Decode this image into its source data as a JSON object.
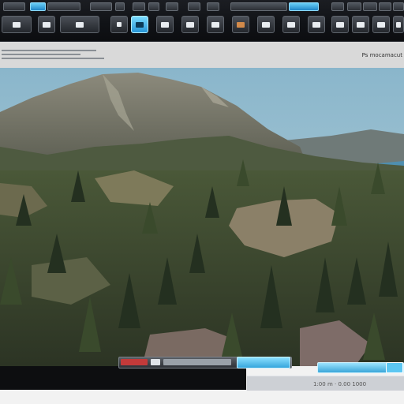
{
  "header": {
    "corner_text": "Ps mocamacut"
  },
  "footer": {
    "text": "1:00 m  ·  0.00  1000"
  },
  "icons": {
    "toolbar": [
      "layers-icon",
      "eye-icon",
      "settings-icon",
      "folder-icon",
      "camera-icon",
      "lock-icon",
      "globe-icon",
      "grid-icon",
      "save-icon",
      "export-icon",
      "info-icon",
      "plus-icon"
    ]
  },
  "colors": {
    "toolbar_bg": "#101216",
    "accent_cyan": "#2694d6",
    "header_bg": "#d9d9d9",
    "sky": "#8fb3c4",
    "forest": "#3d4a32"
  }
}
